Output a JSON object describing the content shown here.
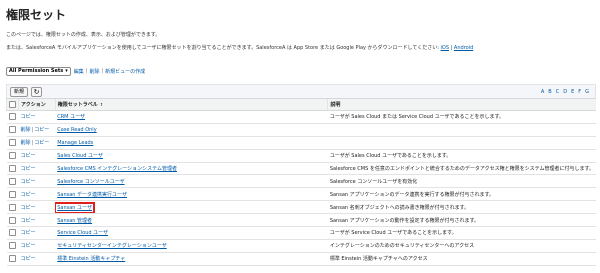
{
  "page": {
    "title": "権限セット",
    "description": "このページでは、権限セットの作成、表示、および管理ができます。",
    "mobile_text": "または、SalesforceA モバイルアプリケーションを使用してユーザに権限セットを割り当てることができます。SalesforceA は App Store または Google Play からダウンロードしてください:",
    "ios_link": "iOS",
    "link_sep": "|",
    "android_link": "Android"
  },
  "viewbar": {
    "selected_view": "All Permission Sets",
    "edit_link": "編集",
    "delete_link": "削除",
    "create_view_link": "新規ビューの作成",
    "sep": "|"
  },
  "toolbar": {
    "new_button": "新規",
    "refresh_icon": "refresh-icon",
    "alpha": [
      "A",
      "B",
      "C",
      "D",
      "E",
      "F",
      "G"
    ]
  },
  "table": {
    "columns": {
      "action": "アクション",
      "label": "権限セットラベル",
      "sort_indicator": "↑",
      "description": "説明"
    },
    "rows": [
      {
        "actions": [
          "コピー"
        ],
        "label": "CRM ユーザ",
        "description": "ユーザが Sales Cloud または Service Cloud ユーザであることを示します。",
        "highlight": false
      },
      {
        "actions": [
          "削除",
          "コピー"
        ],
        "label": "Case Read Only",
        "description": "",
        "highlight": false
      },
      {
        "actions": [
          "削除",
          "コピー"
        ],
        "label": "Manage Leads",
        "description": "",
        "highlight": false
      },
      {
        "actions": [
          "コピー"
        ],
        "label": "Sales Cloud ユーザ",
        "description": "ユーザが Sales Cloud ユーザであることを示します。",
        "highlight": false
      },
      {
        "actions": [
          "コピー"
        ],
        "label": "Salesforce CMS インテグレーションシステム管理者",
        "description": "Salesforce CMS を任意のエンドポイントと統合するためのデータアクセス権と権限をシステム管理者に付与します。",
        "highlight": false
      },
      {
        "actions": [
          "コピー"
        ],
        "label": "Salesforce コンソールユーザ",
        "description": "Salesforce コンソールユーザを有効化",
        "highlight": false
      },
      {
        "actions": [
          "コピー"
        ],
        "label": "Sansan データ連携実行ユーザ",
        "description": "Sansan アプリケーションのデータ連携を実行する権限が付与されます。",
        "highlight": false
      },
      {
        "actions": [
          "コピー"
        ],
        "label": "Sansan ユーザ",
        "description": "Sansan 名刺オブジェクトへの読み書き権限が付与されます。",
        "highlight": true
      },
      {
        "actions": [
          "コピー"
        ],
        "label": "Sansan 管理者",
        "description": "Sansan アプリケーションの動作を設定する権限が付与されます。",
        "highlight": false
      },
      {
        "actions": [
          "コピー"
        ],
        "label": "Service Cloud ユーザ",
        "description": "ユーザが Service Cloud ユーザであることを示します。",
        "highlight": false
      },
      {
        "actions": [
          "コピー"
        ],
        "label": "セキュリティセンターインテグレーションユーザ",
        "description": "インテグレーションのためのセキュリティセンターへのアクセス",
        "highlight": false
      },
      {
        "actions": [
          "コピー"
        ],
        "label": "標準 Einstein 活動キャプチャ",
        "description": "標準 Einstein 活動キャプチャへのアクセス",
        "highlight": false
      }
    ]
  }
}
